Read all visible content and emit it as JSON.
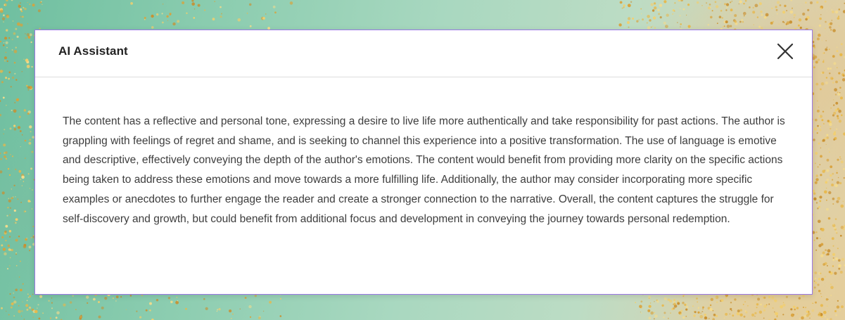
{
  "dialog": {
    "title": "AI Assistant",
    "close_icon": "close-icon",
    "body_text": "The content has a reflective and personal tone, expressing a desire to live life more authentically and take responsibility for past actions. The author is grappling with feelings of regret and shame, and is seeking to channel this experience into a positive transformation. The use of language is emotive and descriptive, effectively conveying the depth of the author's emotions. The content would benefit from providing more clarity on the specific actions being taken to address these emotions and move towards a more fulfilling life. Additionally, the author may consider incorporating more specific examples or anecdotes to further engage the reader and create a stronger connection to the narrative. Overall, the content captures the struggle for self-discovery and growth, but could benefit from additional focus and development in conveying the journey towards personal redemption."
  },
  "colors": {
    "dialog_border": "#9b79e6",
    "background_green": "#8ccdb0",
    "background_gold": "#e4cf9f"
  }
}
